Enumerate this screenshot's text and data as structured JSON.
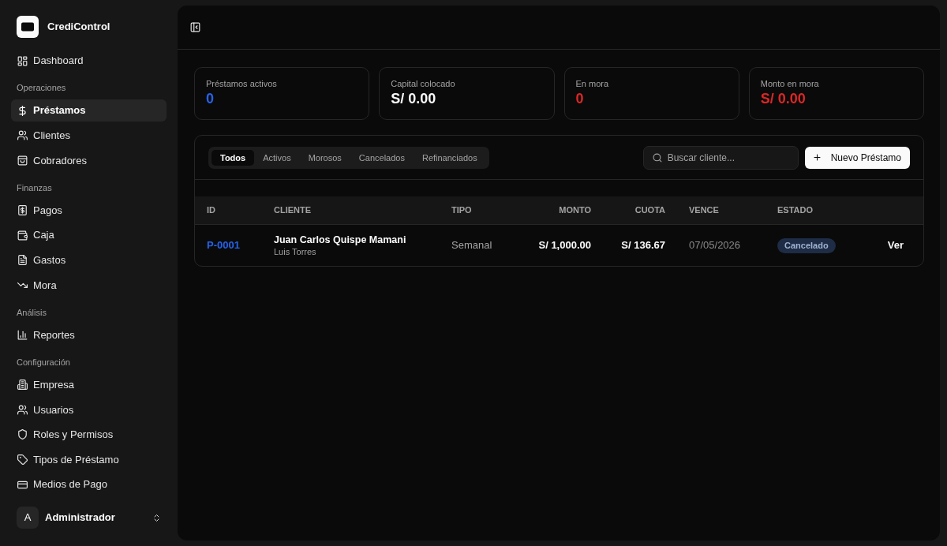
{
  "brand": {
    "name": "CrediControl"
  },
  "sidebar": {
    "groups": [
      {
        "items": [
          {
            "label": "Dashboard",
            "selected": false
          }
        ]
      },
      {
        "heading": "Operaciones",
        "items": [
          {
            "label": "Préstamos",
            "selected": true
          },
          {
            "label": "Clientes",
            "selected": false
          },
          {
            "label": "Cobradores",
            "selected": false
          }
        ]
      },
      {
        "heading": "Finanzas",
        "items": [
          {
            "label": "Pagos",
            "selected": false
          },
          {
            "label": "Caja",
            "selected": false
          },
          {
            "label": "Gastos",
            "selected": false
          },
          {
            "label": "Mora",
            "selected": false
          }
        ]
      },
      {
        "heading": "Análisis",
        "items": [
          {
            "label": "Reportes",
            "selected": false
          }
        ]
      },
      {
        "heading": "Configuración",
        "items": [
          {
            "label": "Empresa",
            "selected": false
          },
          {
            "label": "Usuarios",
            "selected": false
          },
          {
            "label": "Roles y Permisos",
            "selected": false
          },
          {
            "label": "Tipos de Préstamo",
            "selected": false
          },
          {
            "label": "Medios de Pago",
            "selected": false
          }
        ]
      }
    ],
    "user": {
      "initial": "A",
      "name": "Administrador"
    }
  },
  "stats": [
    {
      "label": "Préstamos activos",
      "value": "0",
      "color": "#2563eb"
    },
    {
      "label": "Capital colocado",
      "value": "S/ 0.00",
      "color": "#fafafa"
    },
    {
      "label": "En mora",
      "value": "0",
      "color": "#dc2626"
    },
    {
      "label": "Monto en mora",
      "value": "S/ 0.00",
      "color": "#dc2626"
    }
  ],
  "loans": {
    "tabs": [
      {
        "label": "Todos",
        "selected": true
      },
      {
        "label": "Activos",
        "selected": false
      },
      {
        "label": "Morosos",
        "selected": false
      },
      {
        "label": "Cancelados",
        "selected": false
      },
      {
        "label": "Refinanciados",
        "selected": false
      }
    ],
    "search": {
      "placeholder": "Buscar cliente..."
    },
    "new_button": {
      "label": "Nuevo Préstamo"
    },
    "table": {
      "columns": [
        "ID",
        "CLIENTE",
        "TIPO",
        "MONTO",
        "CUOTA",
        "VENCE",
        "ESTADO"
      ],
      "rows": [
        {
          "id": "P-0001",
          "client": "Juan Carlos Quispe Mamani",
          "client_detail": "Luis Torres",
          "type": "Semanal",
          "amount": "S/ 1,000.00",
          "installment": "S/ 136.67",
          "due": "07/05/2026",
          "status": "Cancelado",
          "action": "Ver"
        }
      ]
    }
  }
}
